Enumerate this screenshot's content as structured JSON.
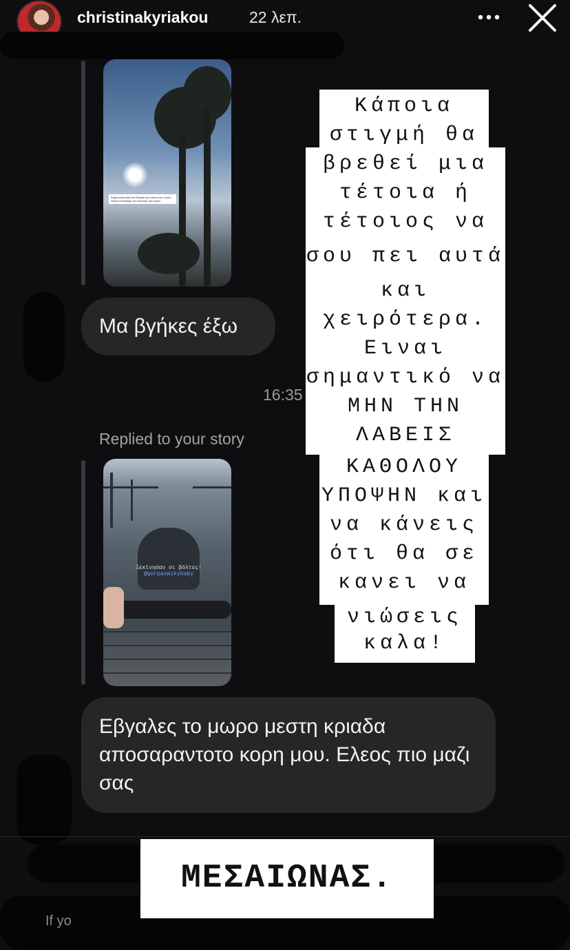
{
  "header": {
    "username": "christinakyriakou",
    "time_ago": "22 λεπ."
  },
  "thread": {
    "story1_caption": "Καμιά κατανυξία δεν διαρκεί για πάντα και ο ήλιος πάντα επιστρέφει πιο δυνατός από πριν!",
    "message1": "Μα βγήκες έξω",
    "timestamp": "16:35",
    "replied_label": "Replied to your story",
    "story2_caption": "Ξεκίνησαν οι βόλτες!",
    "story2_tag": "@gorpasmikybaby",
    "message2": "Εβγαλες το μωρο μεστη κριαδα αποσαραντοτο κορη μου. Ελεος πιο μαζι σας",
    "footer_partial": "If yo"
  },
  "overlay": {
    "lines": [
      "Κάποια",
      "στιγμή θα",
      "βρεθεί μια",
      "τέτοια ή",
      "τέτοιος να",
      "σου πει αυτά",
      "και",
      "χειρότερα.",
      "Ειναι",
      "σημαντικό να",
      "ΜΗΝ ΤΗΝ",
      "ΛΑΒΕΙΣ",
      "ΚΑΘΟΛΟΥ",
      "ΥΠΟΨΗΝ και",
      "να κάνεις",
      "ότι θα σε",
      "κανει να",
      "νιώσεις",
      "καλα!"
    ],
    "banner": "ΜΕΣΑΙΩΝΑΣ."
  },
  "colors": {
    "background": "#0e0e10",
    "bubble": "#262628",
    "card": "#ffffff"
  }
}
